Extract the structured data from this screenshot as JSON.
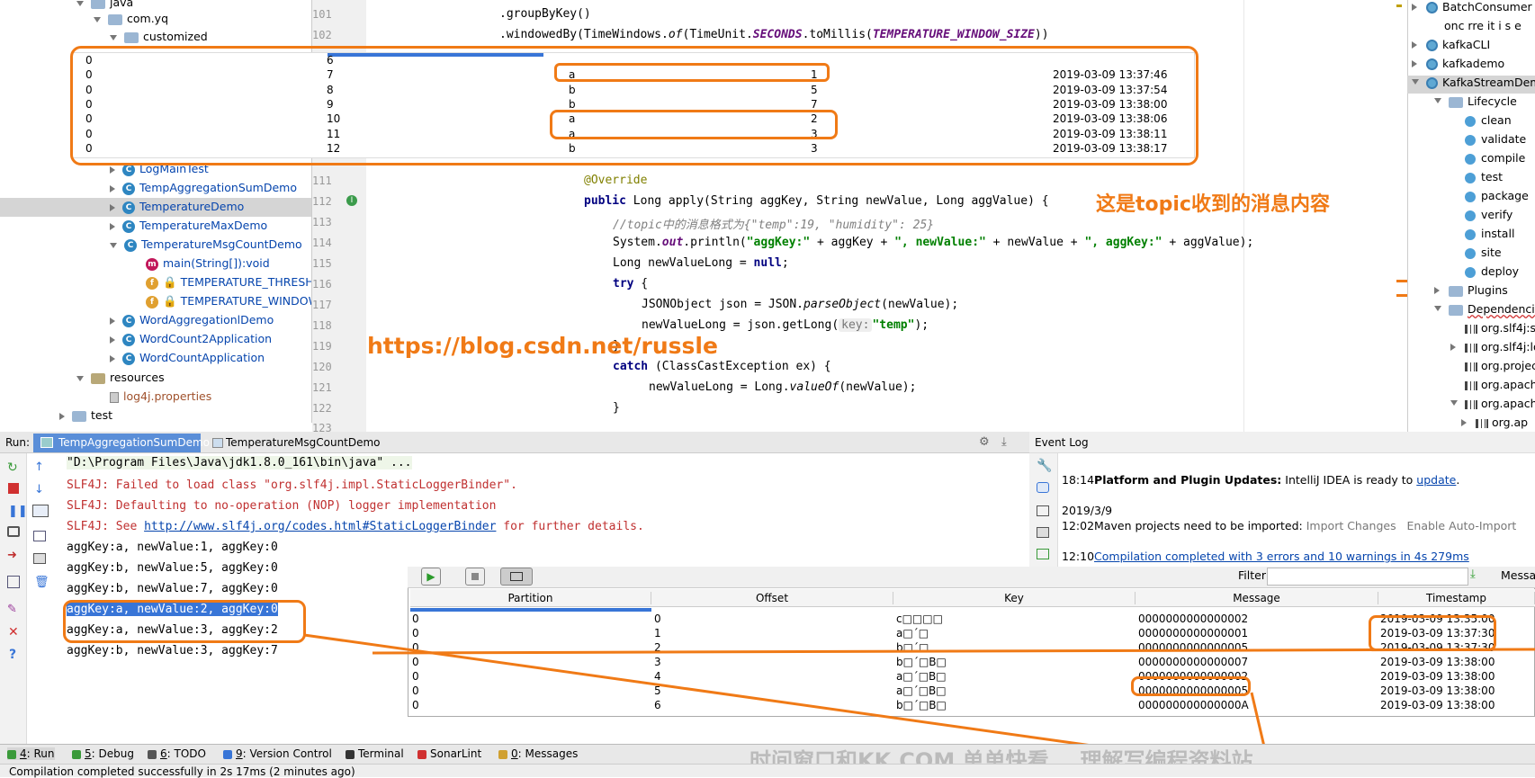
{
  "project_tree": {
    "items": [
      {
        "label": "java",
        "indent": 1
      },
      {
        "label": "com.yq",
        "indent": 2
      },
      {
        "label": "customized",
        "indent": 3
      },
      {
        "label": "LogMainTest",
        "indent": 3
      },
      {
        "label": "TempAggregationSumDemo",
        "indent": 3
      },
      {
        "label": "TemperatureDemo",
        "indent": 3
      },
      {
        "label": "TemperatureMaxDemo",
        "indent": 3
      },
      {
        "label": "TemperatureMsgCountDemo",
        "indent": 3
      },
      {
        "label": "main(String[]):void",
        "indent": 4
      },
      {
        "label": "TEMPERATURE_THRESHO",
        "indent": 4
      },
      {
        "label": "TEMPERATURE_WINDOW",
        "indent": 4
      },
      {
        "label": "WordAggregationlDemo",
        "indent": 3
      },
      {
        "label": "WordCount2Application",
        "indent": 3
      },
      {
        "label": "WordCountApplication",
        "indent": 3
      },
      {
        "label": "resources",
        "indent": 1
      },
      {
        "label": "log4j.properties",
        "indent": 2
      },
      {
        "label": "test",
        "indent": 0
      }
    ]
  },
  "editor": {
    "line_numbers": [
      "101",
      "102",
      "111",
      "112",
      "113",
      "114",
      "115",
      "116",
      "117",
      "118",
      "119",
      "120",
      "121",
      "122",
      "123"
    ],
    "code": {
      "l101": ".groupByKey()",
      "l102a": ".windowedBy(TimeWindows.",
      "l102b": "of",
      "l102c": "(TimeUnit.",
      "l102d": "SECONDS",
      "l102e": ".toMillis(",
      "l102f": "TEMPERATURE_WINDOW_SIZE",
      "l102g": "))",
      "l111": "@Override",
      "l112a": "public",
      "l112b": " Long apply(String aggKey, String newValue, Long aggValue) {",
      "l113": "//topic中的消息格式为{\"temp\":19, \"humidity\": 25}",
      "l114a": "System.",
      "l114b": "out",
      "l114c": ".println(",
      "l114d": "\"aggKey:\"",
      "l114e": " + aggKey + ",
      "l114f": "\",  newValue:\"",
      "l114g": " + newValue + ",
      "l114h": "\", aggKey:\"",
      "l114i": " + aggValue);",
      "l115a": "Long newValueLong = ",
      "l115b": "null",
      "l115c": ";",
      "l116a": "try",
      "l116b": " {",
      "l117a": "JSONObject json = JSON.",
      "l117b": "parseObject",
      "l117c": "(newValue);",
      "l118a": "newValueLong = json.getLong(",
      "l118b": "key:",
      "l118c": "\"temp\"",
      "l118d": ");",
      "l119": "}",
      "l120a": "catch",
      "l120b": " (ClassCastException ex) {",
      "l121a": "newValueLong = Long.",
      "l121b": "valueOf",
      "l121c": "(newValue);",
      "l122": "}"
    }
  },
  "overlay_table": {
    "rows": [
      {
        "p": "0",
        "off": "6",
        "key": "",
        "cnt": "",
        "ts": ""
      },
      {
        "p": "0",
        "off": "7",
        "key": "a",
        "cnt": "1",
        "ts": "2019-03-09 13:37:46"
      },
      {
        "p": "0",
        "off": "8",
        "key": "b",
        "cnt": "5",
        "ts": "2019-03-09 13:37:54"
      },
      {
        "p": "0",
        "off": "9",
        "key": "b",
        "cnt": "7",
        "ts": "2019-03-09 13:38:00"
      },
      {
        "p": "0",
        "off": "10",
        "key": "a",
        "cnt": "2",
        "ts": "2019-03-09 13:38:06"
      },
      {
        "p": "0",
        "off": "11",
        "key": "a",
        "cnt": "3",
        "ts": "2019-03-09 13:38:11"
      },
      {
        "p": "0",
        "off": "12",
        "key": "b",
        "cnt": "3",
        "ts": "2019-03-09 13:38:17"
      }
    ]
  },
  "annotations": {
    "chinese_note": "这是topic收到的消息内容",
    "watermark_url": "https://blog.csdn.net/russle",
    "bottom_watermark": "时间窗口和KK.COM 单单快看 .. 理解写编程资料站"
  },
  "maven": {
    "items": [
      "BatchConsumer",
      "onc rre it i s e",
      "kafkaCLI",
      "kafkademo",
      "KafkaStreamDem",
      "Lifecycle",
      "clean",
      "validate",
      "compile",
      "test",
      "package",
      "verify",
      "install",
      "site",
      "deploy",
      "Plugins",
      "Dependencies",
      "org.slf4j:sl",
      "org.slf4j:lo",
      "org.projec",
      "org.apach",
      "org.apach",
      "org.ap"
    ]
  },
  "run": {
    "label": "Run:",
    "tabs": [
      "TempAggregationSumDemo",
      "TemperatureMsgCountDemo"
    ],
    "output": [
      "\"D:\\Program Files\\Java\\jdk1.8.0_161\\bin\\java\" ...",
      "SLF4J: Failed to load class \"org.slf4j.impl.StaticLoggerBinder\".",
      "SLF4J: Defaulting to no-operation (NOP) logger implementation",
      "SLF4J: See ",
      "http://www.slf4j.org/codes.html#StaticLoggerBinder",
      " for further details.",
      "aggKey:a,  newValue:1, aggKey:0",
      "aggKey:b,  newValue:5, aggKey:0",
      "aggKey:b,  newValue:7, aggKey:0",
      "aggKey:a,  newValue:2, aggKey:0",
      "aggKey:a,  newValue:3, aggKey:2",
      "aggKey:b,  newValue:3, aggKey:7"
    ]
  },
  "event_log": {
    "title": "Event Log",
    "e1_time": "18:14",
    "e1_bold": "Platform and Plugin Updates:",
    "e1_text": " IntelliJ IDEA is ready to ",
    "e1_link": "update",
    "e1_end": ".",
    "date": "2019/3/9",
    "e2_time": "12:02",
    "e2_text": "Maven projects need to be imported: ",
    "e2_a1": "Import Changes",
    "e2_a2": "Enable Auto-Import",
    "e3_time": "12:10",
    "e3_link": "Compilation completed with 3 errors and 10 warnings in 4s 279ms"
  },
  "kafka_tool": {
    "filter_label": "Filter",
    "messa": "Messa",
    "headers": [
      "Partition",
      "Offset",
      "Key",
      "Message",
      "Timestamp"
    ],
    "rows": [
      {
        "p": "0",
        "o": "0",
        "k": "c□□□□",
        "m": "0000000000000002",
        "t": "2019-03-09 13:35:00"
      },
      {
        "p": "0",
        "o": "1",
        "k": "a□´□",
        "m": "0000000000000001",
        "t": "2019-03-09 13:37:30"
      },
      {
        "p": "0",
        "o": "2",
        "k": "b□´□",
        "m": "0000000000000005",
        "t": "2019-03-09 13:37:30"
      },
      {
        "p": "0",
        "o": "3",
        "k": "b□´□B□",
        "m": "0000000000000007",
        "t": "2019-03-09 13:38:00"
      },
      {
        "p": "0",
        "o": "4",
        "k": "a□´□B□",
        "m": "0000000000000002",
        "t": "2019-03-09 13:38:00"
      },
      {
        "p": "0",
        "o": "5",
        "k": "a□´□B□",
        "m": "0000000000000005",
        "t": "2019-03-09 13:38:00"
      },
      {
        "p": "0",
        "o": "6",
        "k": "b□´□B□",
        "m": "000000000000000A",
        "t": "2019-03-09 13:38:00"
      }
    ]
  },
  "status_tabs": [
    {
      "n": "4",
      "label": ": Run"
    },
    {
      "n": "5",
      "label": ": Debug"
    },
    {
      "n": "6",
      "label": ": TODO"
    },
    {
      "n": "9",
      "label": ": Version Control"
    },
    {
      "n": "",
      "label": "Terminal"
    },
    {
      "n": "",
      "label": "SonarLint"
    },
    {
      "n": "0",
      "label": ": Messages"
    }
  ],
  "status_bar": "Compilation completed successfully in 2s 17ms (2 minutes ago)",
  "colors": {
    "accent_orange": "#f07a16",
    "link_blue": "#0645ad",
    "selection": "#3875d7"
  }
}
